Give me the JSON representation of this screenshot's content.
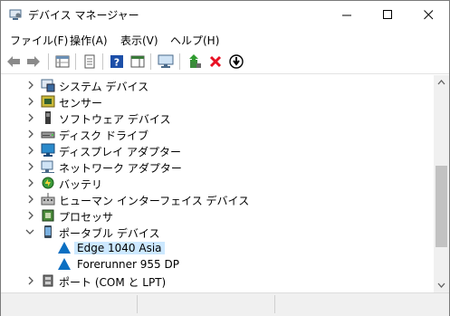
{
  "window": {
    "title": "デバイス マネージャー"
  },
  "menu": [
    {
      "label": "ファイル(F)"
    },
    {
      "label": "操作(A)"
    },
    {
      "label": "表示(V)"
    },
    {
      "label": "ヘルプ(H)"
    }
  ],
  "toolbar": {
    "icons": [
      "back-arrow-icon",
      "forward-arrow-icon",
      "properties-grid-icon",
      "page-icon",
      "help-icon",
      "console-icon",
      "monitor-icon",
      "update-driver-icon",
      "uninstall-x-icon",
      "download-icon"
    ]
  },
  "tree": {
    "items": [
      {
        "label": "システム デバイス",
        "expanded": false,
        "icon": "system-devices-icon"
      },
      {
        "label": "センサー",
        "expanded": false,
        "icon": "sensor-icon"
      },
      {
        "label": "ソフトウェア デバイス",
        "expanded": false,
        "icon": "software-device-icon"
      },
      {
        "label": "ディスク ドライブ",
        "expanded": false,
        "icon": "disk-drive-icon"
      },
      {
        "label": "ディスプレイ アダプター",
        "expanded": false,
        "icon": "display-adapter-icon"
      },
      {
        "label": "ネットワーク アダプター",
        "expanded": false,
        "icon": "network-adapter-icon"
      },
      {
        "label": "バッテリ",
        "expanded": false,
        "icon": "battery-icon"
      },
      {
        "label": "ヒューマン インターフェイス デバイス",
        "expanded": false,
        "icon": "hid-icon"
      },
      {
        "label": "プロセッサ",
        "expanded": false,
        "icon": "processor-icon"
      },
      {
        "label": "ポータブル デバイス",
        "expanded": true,
        "icon": "portable-device-icon"
      },
      {
        "label": "Edge 1040 Asia",
        "child": true,
        "selected": true,
        "icon": "garmin-triangle-icon"
      },
      {
        "label": "Forerunner 955 DP",
        "child": true,
        "icon": "garmin-triangle-icon"
      },
      {
        "label": "ポート (COM と LPT)",
        "expanded": false,
        "icon": "port-icon"
      }
    ]
  },
  "colors": {
    "accent": "#0b6fc2",
    "selection": "#cce8ff",
    "remove": "#e81123"
  }
}
